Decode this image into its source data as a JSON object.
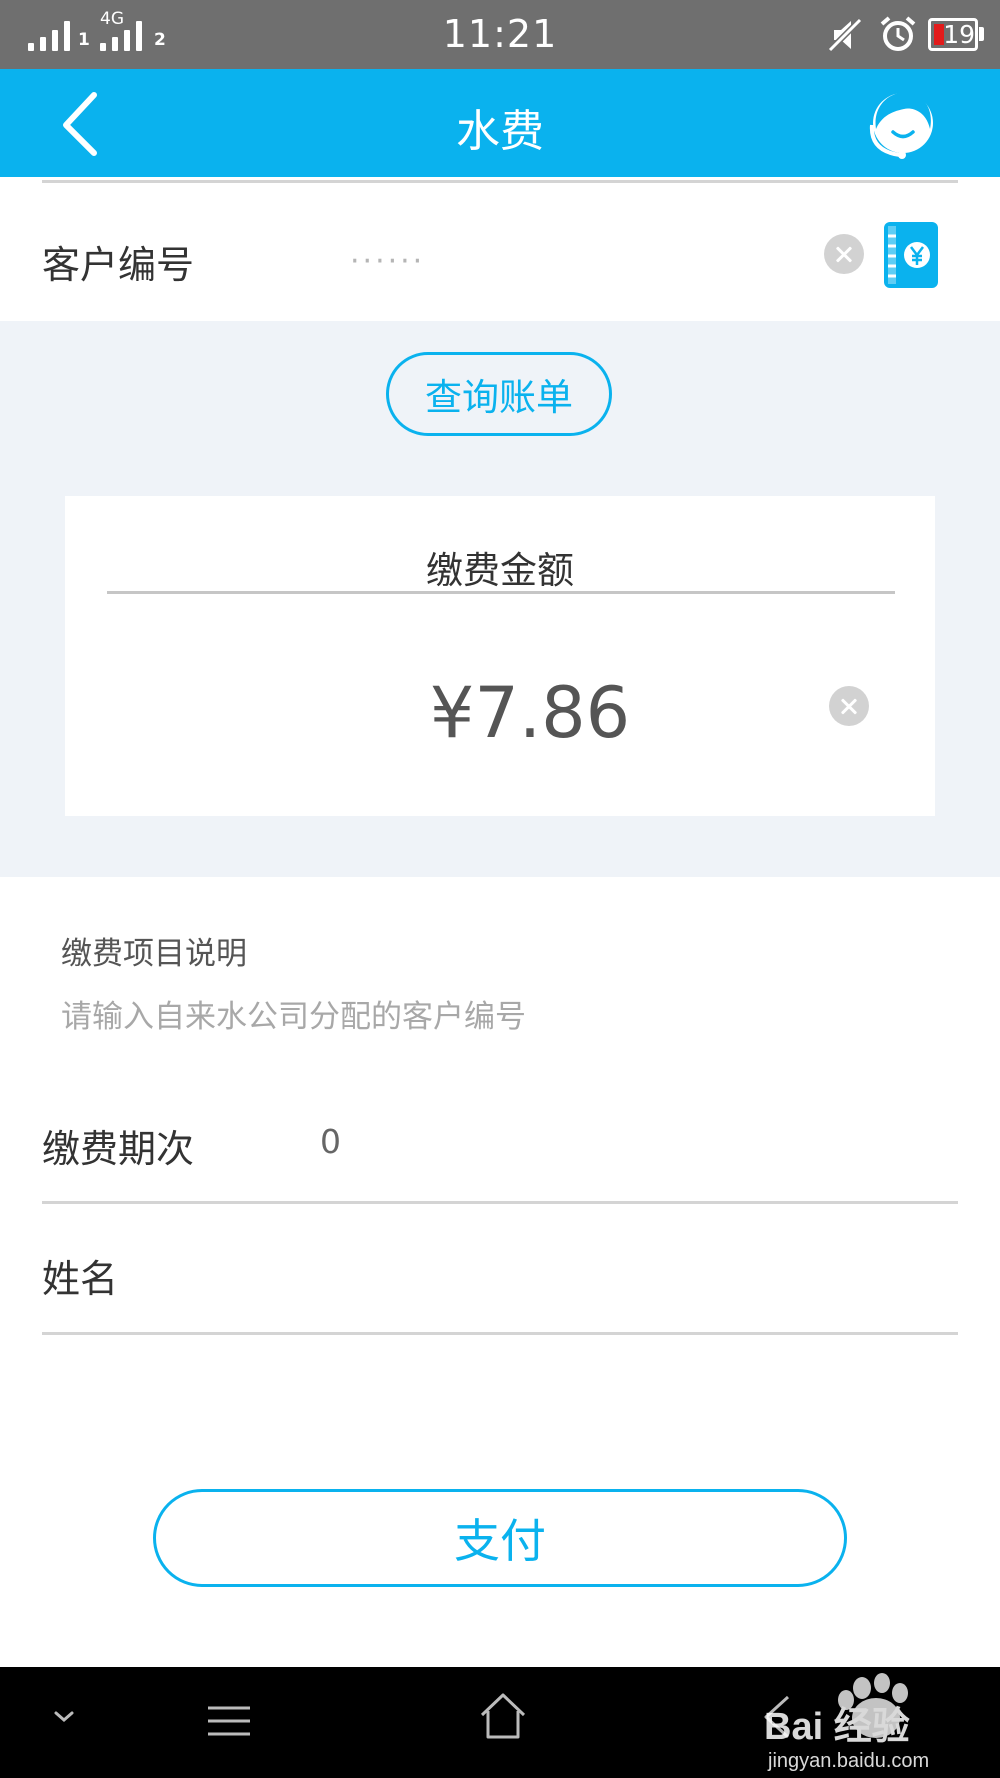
{
  "status_bar": {
    "sim1": "1",
    "sim2": "2",
    "network": "4G",
    "time": "11:21",
    "battery": "19",
    "icons": [
      "signal-icon",
      "mute-icon",
      "alarm-icon",
      "battery-icon"
    ]
  },
  "header": {
    "title": "水费",
    "back_icon": "chevron-left-icon",
    "service_icon": "customer-service-icon"
  },
  "customer_id": {
    "label": "客户编号",
    "value": "······"
  },
  "query_button": "查询账单",
  "amount": {
    "title": "缴费金额",
    "value": "¥7.86"
  },
  "description": {
    "heading": "缴费项目说明",
    "text": "请输入自来水公司分配的客户编号"
  },
  "fields": {
    "period_label": "缴费期次",
    "period_value": "0",
    "name_label": "姓名"
  },
  "pay_button": "支付",
  "watermark": {
    "brand_text": "Bai 经验",
    "url": "jingyan.baidu.com"
  },
  "colors": {
    "accent": "#0ab2ee",
    "status_bar": "#6f6f6f",
    "panel_background": "#eff3f8",
    "battery_low": "#e21b1b"
  }
}
